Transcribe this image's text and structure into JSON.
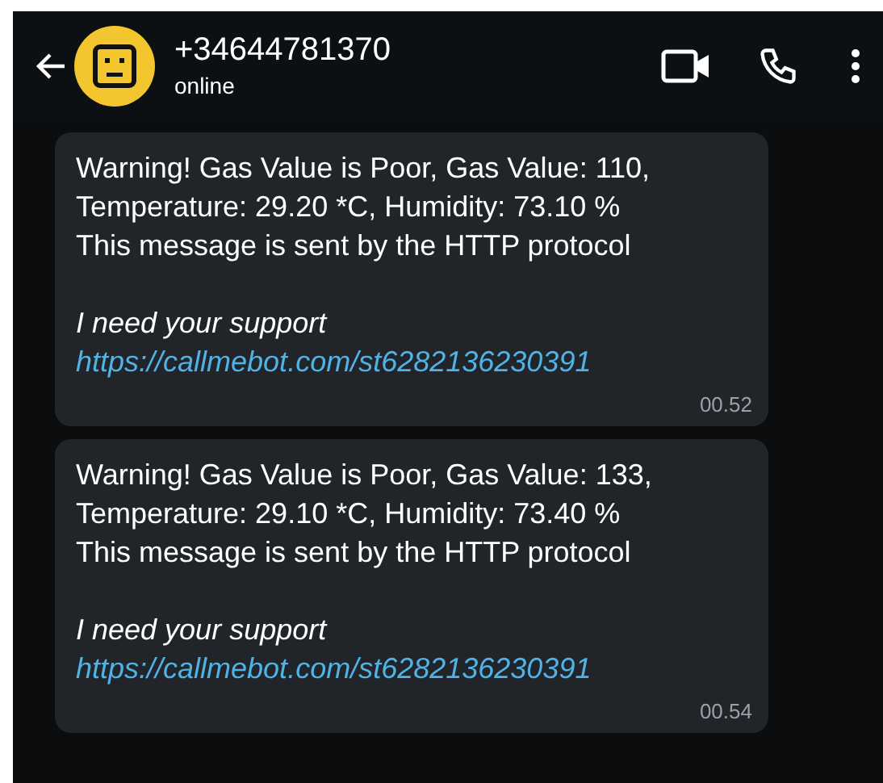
{
  "header": {
    "contact": "+34644781370",
    "status": "online"
  },
  "messages": [
    {
      "lines": [
        "Warning! Gas Value is Poor, Gas Value: 110,",
        "Temperature: 29.20 *C, Humidity: 73.10 %",
        "This message is sent by the HTTP protocol"
      ],
      "note": "I need your support",
      "link": "https://callmebot.com/st6282136230391",
      "time": "00.52"
    },
    {
      "lines": [
        "Warning! Gas Value is Poor, Gas Value: 133,",
        "Temperature: 29.10 *C, Humidity: 73.40 %",
        "This message is sent by the HTTP protocol"
      ],
      "note": "I need your support",
      "link": "https://callmebot.com/st6282136230391",
      "time": "00.54"
    }
  ]
}
